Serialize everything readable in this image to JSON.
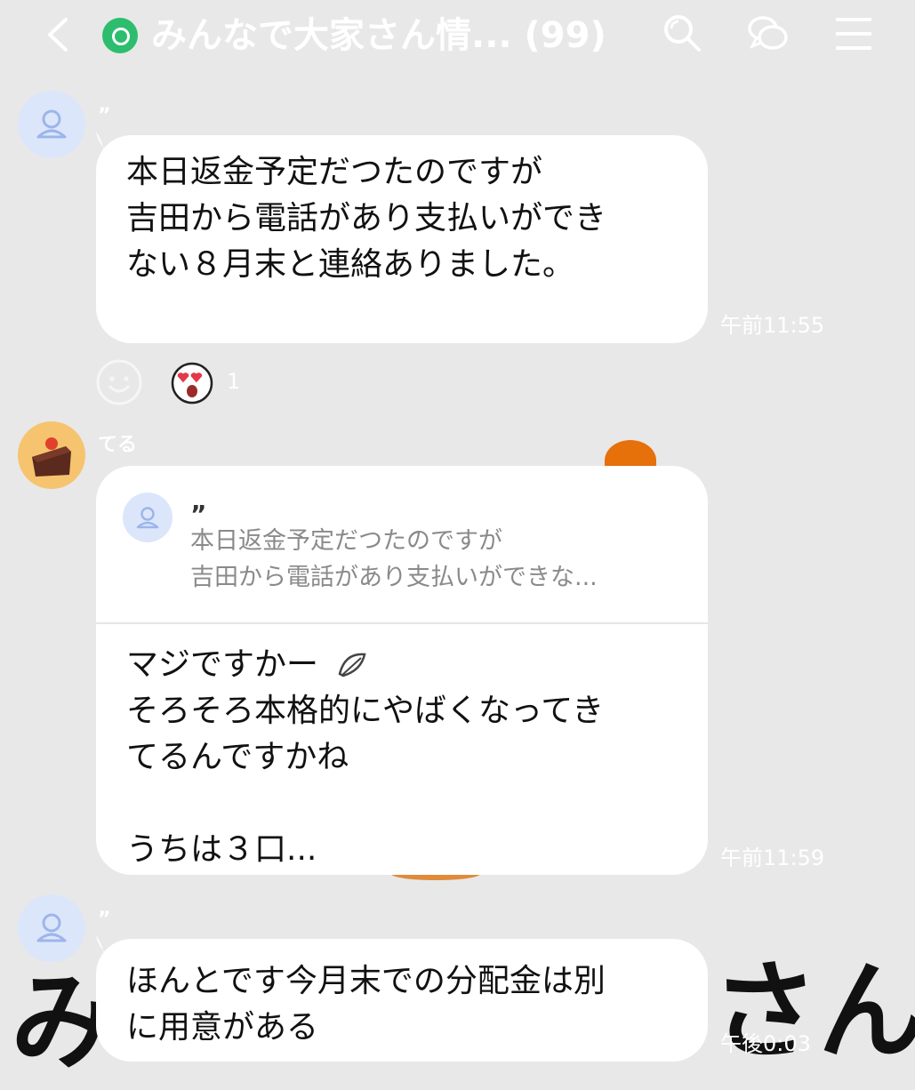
{
  "header": {
    "title": "みんなで大家さん情... (99)",
    "icons": [
      "back-icon",
      "group-icon",
      "search-icon",
      "chat-icon",
      "menu-icon"
    ]
  },
  "messages": [
    {
      "sender": "”",
      "text": "本日返金予定だつたのですが\n吉田から電話があり支払いができ\nない８月末と連絡ありました。",
      "time": "午前11:55",
      "reaction_count": "1"
    },
    {
      "sender": "てる",
      "quote_sender": "”",
      "quote_text": "本日返金予定だつたのですが\n吉田から電話があり支払いができな...",
      "text": "マジですかー\nそろそろ本格的にやばくなってき\nてるんですかね\n\nうちは３口...",
      "time": "午前11:59"
    },
    {
      "sender": "”",
      "text": "ほんとです今月末での分配金は別\nに用意がある",
      "time": "午後0:03"
    }
  ],
  "watermark": {
    "left": "み",
    "right": "さん"
  },
  "colors": {
    "background": "#e8e8e8",
    "bubble": "#ffffff",
    "group_badge": "#2dbd6e",
    "avatar_default": "#dce6fb",
    "avatar_cake": "#f6c46f"
  }
}
